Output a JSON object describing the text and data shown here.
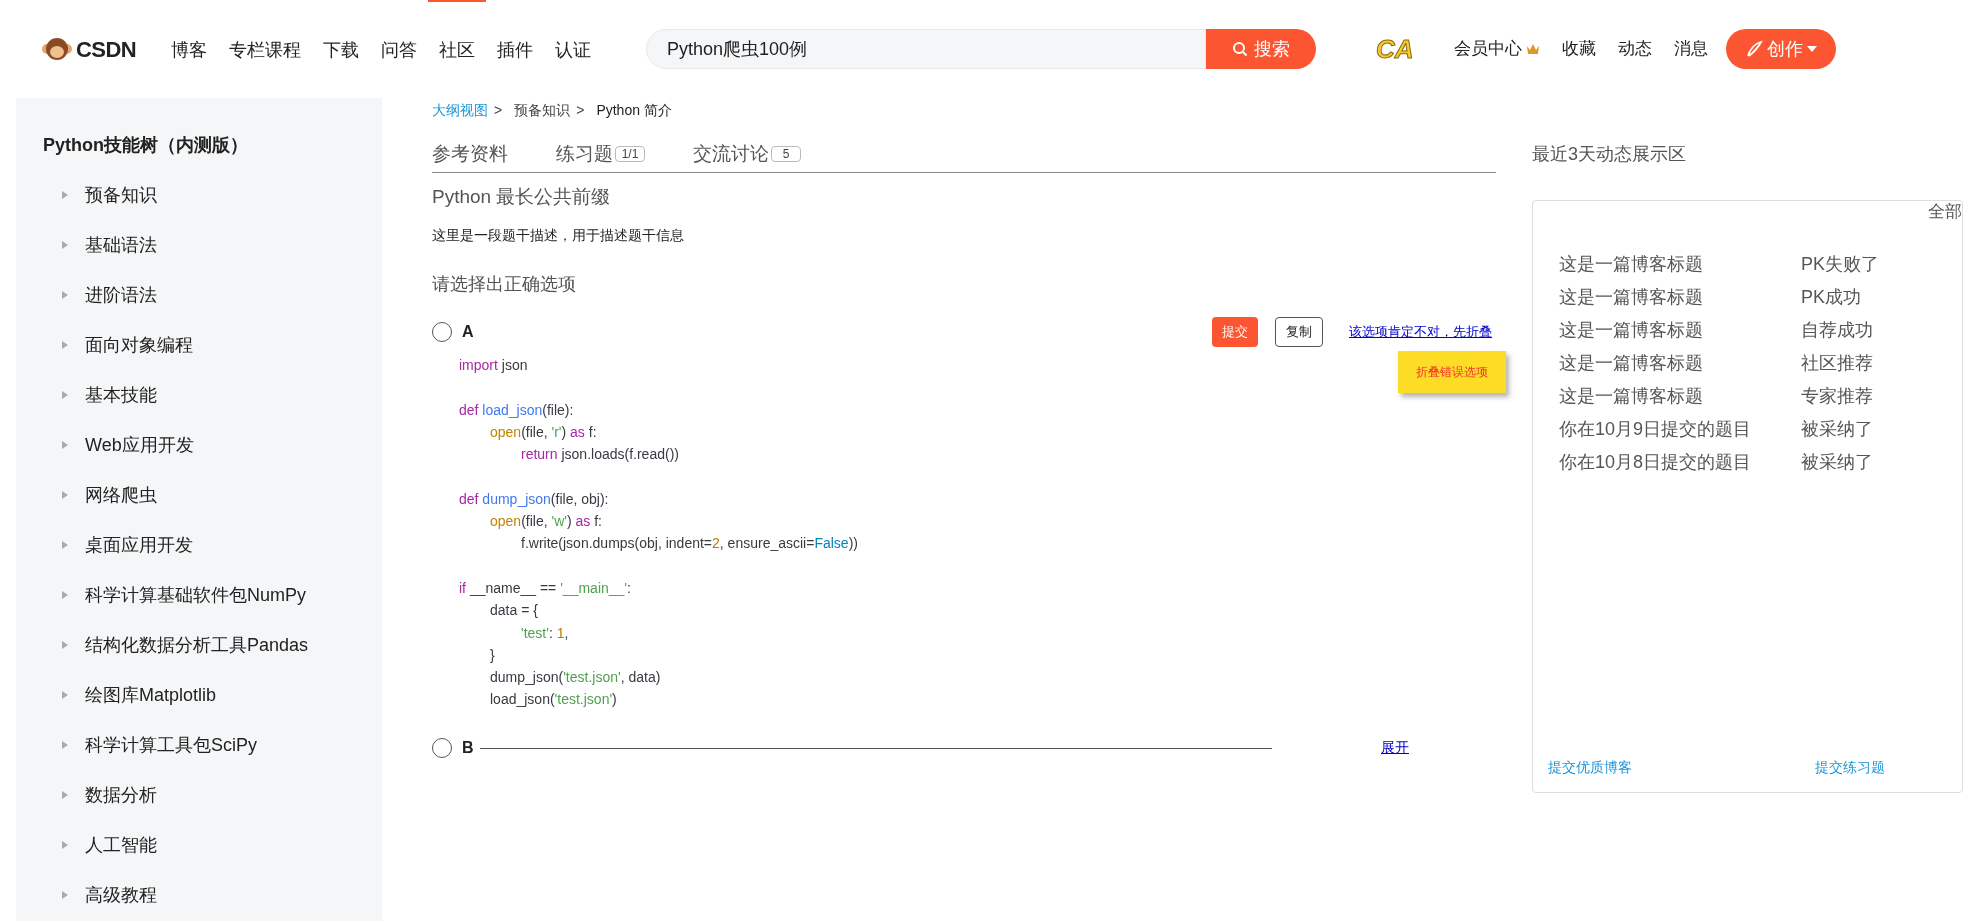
{
  "header": {
    "logo_text": "CSDN",
    "nav": [
      {
        "label": "博客",
        "selected": false
      },
      {
        "label": "专栏课程",
        "selected": false
      },
      {
        "label": "下载",
        "selected": false
      },
      {
        "label": "问答",
        "selected": false
      },
      {
        "label": "社区",
        "selected": true
      },
      {
        "label": "插件",
        "selected": false
      },
      {
        "label": "认证",
        "selected": false
      }
    ],
    "search": {
      "value": "Python爬虫100例",
      "button": "搜索"
    },
    "badge_text": "CA",
    "links": [
      {
        "label": "会员中心",
        "kind": "vip"
      },
      {
        "label": "收藏",
        "kind": "plain"
      },
      {
        "label": "动态",
        "kind": "plain"
      },
      {
        "label": "消息",
        "kind": "plain"
      }
    ],
    "create_button": "创作"
  },
  "sidebar": {
    "title": "Python技能树（内测版）",
    "items": [
      {
        "label": "预备知识",
        "expanded": false
      },
      {
        "label": "基础语法",
        "expanded": false
      },
      {
        "label": "进阶语法",
        "expanded": false
      },
      {
        "label": "面向对象编程",
        "expanded": false
      },
      {
        "label": "基本技能",
        "expanded": false
      },
      {
        "label": "Web应用开发",
        "expanded": false
      },
      {
        "label": "网络爬虫",
        "expanded": false
      },
      {
        "label": "桌面应用开发",
        "expanded": false
      },
      {
        "label": "科学计算基础软件包NumPy",
        "expanded": false
      },
      {
        "label": "结构化数据分析工具Pandas",
        "expanded": false
      },
      {
        "label": "绘图库Matplotlib",
        "expanded": false
      },
      {
        "label": "科学计算工具包SciPy",
        "expanded": false
      },
      {
        "label": "数据分析",
        "expanded": false
      },
      {
        "label": "人工智能",
        "expanded": false
      },
      {
        "label": "高级教程",
        "expanded": false
      }
    ]
  },
  "breadcrumb": [
    {
      "label": "大纲视图",
      "kind": "link",
      "separator": ">"
    },
    {
      "label": "预备知识",
      "kind": "text",
      "separator": ">"
    },
    {
      "label": "Python 简介",
      "kind": "current"
    }
  ],
  "tabs": [
    {
      "label": "参考资料"
    },
    {
      "label": "练习题",
      "count": "1/1"
    },
    {
      "label": "交流讨论",
      "count": "5"
    }
  ],
  "question": {
    "title": "Python 最长公共前缀",
    "description": "这里是一段题干描述，用于描述题干信息",
    "prompt": "请选择出正确选项",
    "options": [
      {
        "label": "A",
        "selected": false,
        "collapsed": false,
        "submit": "提交",
        "copy": "复制",
        "fold_link": "该选项肯定不对，先折叠",
        "tooltip": "折叠错误选项",
        "code": [
          {
            "tokens": [
              {
                "kind": "kw",
                "text": "import"
              },
              {
                "kind": "plain",
                "text": " json"
              }
            ]
          },
          {
            "blank_before": true,
            "tokens": [
              {
                "kind": "kw",
                "text": "def"
              },
              {
                "kind": "fn",
                "text": " load_json"
              },
              {
                "kind": "plain",
                "text": "(file):"
              }
            ],
            "children": [
              {
                "tokens": [
                  {
                    "kind": "builtin",
                    "text": "open"
                  },
                  {
                    "kind": "plain",
                    "text": "(file, "
                  },
                  {
                    "kind": "str",
                    "text": "'r'"
                  },
                  {
                    "kind": "plain",
                    "text": ") "
                  },
                  {
                    "kind": "kw",
                    "text": "as"
                  },
                  {
                    "kind": "plain",
                    "text": " f:"
                  }
                ],
                "children": [
                  {
                    "tokens": [
                      {
                        "kind": "kw",
                        "text": "return"
                      },
                      {
                        "kind": "plain",
                        "text": " json.loads(f.read())"
                      }
                    ]
                  }
                ]
              }
            ]
          },
          {
            "blank_before": true,
            "tokens": [
              {
                "kind": "kw",
                "text": "def"
              },
              {
                "kind": "fn",
                "text": " dump_json"
              },
              {
                "kind": "plain",
                "text": "(file, obj):"
              }
            ],
            "children": [
              {
                "tokens": [
                  {
                    "kind": "builtin",
                    "text": "open"
                  },
                  {
                    "kind": "plain",
                    "text": "(file, "
                  },
                  {
                    "kind": "str",
                    "text": "'w'"
                  },
                  {
                    "kind": "plain",
                    "text": ") "
                  },
                  {
                    "kind": "kw",
                    "text": "as"
                  },
                  {
                    "kind": "plain",
                    "text": " f:"
                  }
                ],
                "children": [
                  {
                    "tokens": [
                      {
                        "kind": "plain",
                        "text": "f.write(json.dumps(obj, indent="
                      },
                      {
                        "kind": "num",
                        "text": "2"
                      },
                      {
                        "kind": "plain",
                        "text": ", ensure_ascii="
                      },
                      {
                        "kind": "bool",
                        "text": "False"
                      },
                      {
                        "kind": "plain",
                        "text": "))"
                      }
                    ]
                  }
                ]
              }
            ]
          },
          {
            "blank_before": true,
            "tokens": [
              {
                "kind": "kw",
                "text": "if"
              },
              {
                "kind": "plain",
                "text": " __name__ == "
              },
              {
                "kind": "str",
                "text": "'__main__'"
              },
              {
                "kind": "plain",
                "text": ":"
              }
            ],
            "children": [
              {
                "tokens": [
                  {
                    "kind": "plain",
                    "text": "data = {"
                  }
                ],
                "children": [
                  {
                    "tokens": [
                      {
                        "kind": "str",
                        "text": "'test'"
                      },
                      {
                        "kind": "plain",
                        "text": ": "
                      },
                      {
                        "kind": "num",
                        "text": "1"
                      },
                      {
                        "kind": "plain",
                        "text": ","
                      }
                    ]
                  }
                ]
              },
              {
                "tokens": [
                  {
                    "kind": "plain",
                    "text": "}"
                  }
                ]
              },
              {
                "tokens": [
                  {
                    "kind": "plain",
                    "text": "dump_json("
                  },
                  {
                    "kind": "str",
                    "text": "'test.json'"
                  },
                  {
                    "kind": "plain",
                    "text": ", data)"
                  }
                ]
              },
              {
                "tokens": [
                  {
                    "kind": "plain",
                    "text": "load_json("
                  },
                  {
                    "kind": "str",
                    "text": "'test.json'"
                  },
                  {
                    "kind": "plain",
                    "text": ")"
                  }
                ]
              }
            ]
          }
        ]
      },
      {
        "label": "B",
        "selected": false,
        "collapsed": true,
        "expand_link": "展开"
      }
    ]
  },
  "activity": {
    "title": "最近3天动态展示区",
    "filter": "全部",
    "rows": [
      {
        "subject": "这是一篇博客标题",
        "status": "PK失败了"
      },
      {
        "subject": "这是一篇博客标题",
        "status": "PK成功"
      },
      {
        "subject": "这是一篇博客标题",
        "status": "自荐成功"
      },
      {
        "subject": "这是一篇博客标题",
        "status": "社区推荐"
      },
      {
        "subject": "这是一篇博客标题",
        "status": "专家推荐"
      },
      {
        "subject": "你在10月9日提交的题目",
        "status": "被采纳了"
      },
      {
        "subject": "你在10月8日提交的题目",
        "status": "被采纳了"
      }
    ],
    "footer_links": [
      "提交优质博客",
      "提交练习题"
    ]
  }
}
